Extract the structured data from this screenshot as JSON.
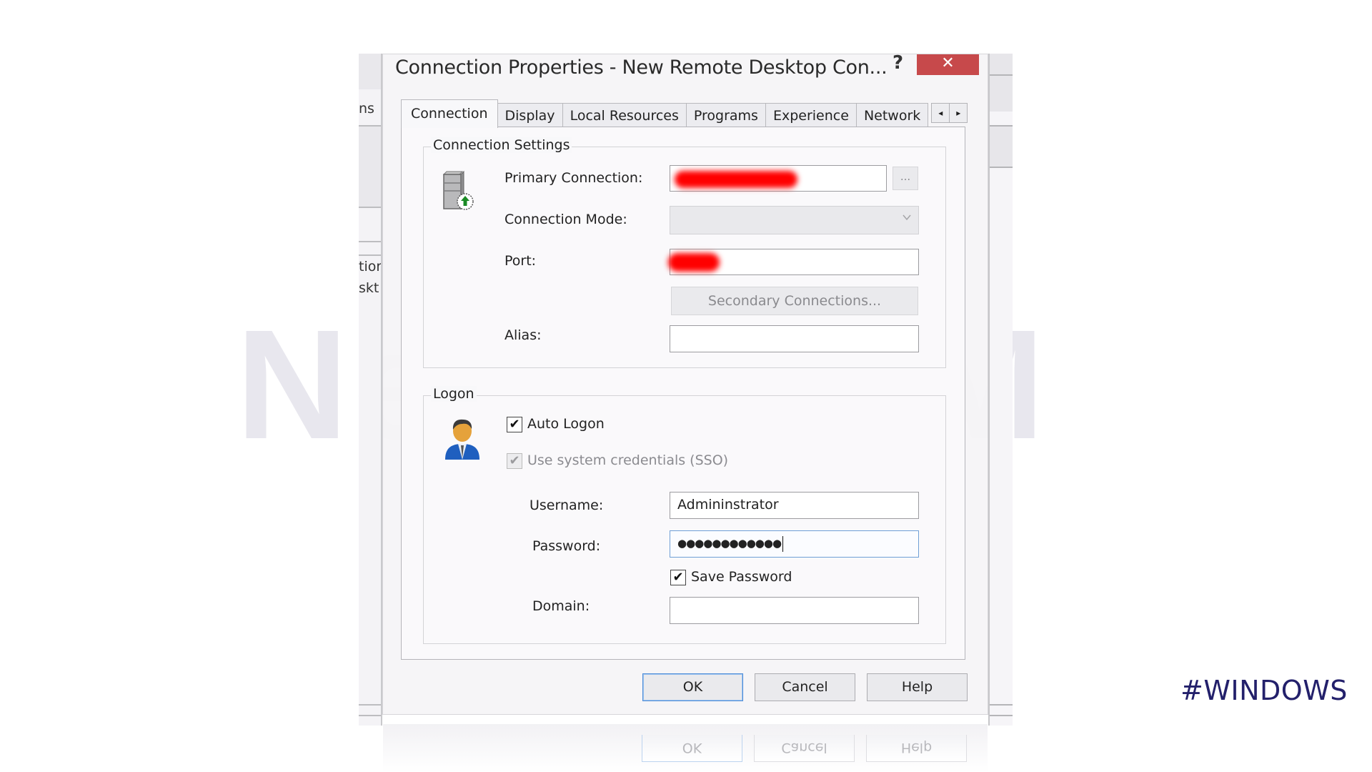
{
  "watermark": "NeuronVM",
  "tag": "#WINDOWS",
  "background_windows": {
    "left_fragments": [
      "ns",
      "tior",
      "skt"
    ]
  },
  "dialog": {
    "title": "Connection Properties - New Remote Desktop Con...",
    "help_glyph": "?",
    "close_glyph": "✕",
    "tabs": [
      {
        "label": "Connection",
        "active": true
      },
      {
        "label": "Display",
        "active": false
      },
      {
        "label": "Local Resources",
        "active": false
      },
      {
        "label": "Programs",
        "active": false
      },
      {
        "label": "Experience",
        "active": false
      },
      {
        "label": "Network",
        "active": false
      }
    ],
    "tab_scroll_left": "◂",
    "tab_scroll_right": "▸",
    "connection_settings": {
      "group_label": "Connection Settings",
      "icon": "server-connect-icon",
      "primary_connection_label": "Primary Connection:",
      "primary_connection_value": "[redacted]",
      "browse_button_label": "...",
      "connection_mode_label": "Connection Mode:",
      "connection_mode_value": "",
      "port_label": "Port:",
      "port_value": "[redacted]",
      "secondary_connections_label": "Secondary Connections...",
      "alias_label": "Alias:",
      "alias_value": ""
    },
    "logon": {
      "group_label": "Logon",
      "icon": "user-icon",
      "auto_logon_label": "Auto Logon",
      "auto_logon_checked": true,
      "sso_label": "Use system credentials (SSO)",
      "sso_checked": true,
      "sso_enabled": false,
      "username_label": "Username:",
      "username_value": "Admininstrator",
      "password_label": "Password:",
      "password_masked": "●●●●●●●●●●●●",
      "save_password_label": "Save Password",
      "save_password_checked": true,
      "domain_label": "Domain:",
      "domain_value": ""
    },
    "buttons": {
      "ok": "OK",
      "cancel": "Cancel",
      "help": "Help"
    },
    "check_glyph": "✔"
  }
}
